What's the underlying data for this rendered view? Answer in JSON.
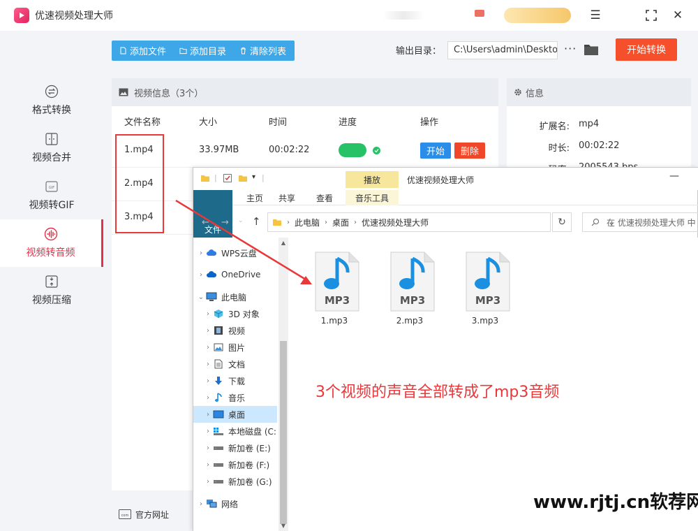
{
  "app": {
    "title": "优速视频处理大师"
  },
  "sidebar": {
    "items": [
      {
        "label": "格式转换",
        "icon": "swap-icon",
        "active": false
      },
      {
        "label": "视频合并",
        "icon": "merge-icon",
        "active": false
      },
      {
        "label": "视频转GIF",
        "icon": "gif-icon",
        "active": false
      },
      {
        "label": "视频转音频",
        "icon": "audio-icon",
        "active": true
      },
      {
        "label": "视频压缩",
        "icon": "compress-icon",
        "active": false
      }
    ]
  },
  "toolbar": {
    "add_file": "添加文件",
    "add_folder": "添加目录",
    "clear_list": "清除列表",
    "output_label": "输出目录：",
    "output_path": "C:\\Users\\admin\\Desktop",
    "more": "···",
    "start_convert": "开始转换"
  },
  "video_panel": {
    "title": "视频信息（3个）",
    "columns": [
      "文件名称",
      "大小",
      "时间",
      "进度",
      "操作"
    ],
    "rows": [
      {
        "name": "1.mp4",
        "size": "33.97MB",
        "time": "00:02:22",
        "progress": 1.0
      },
      {
        "name": "2.mp4",
        "size": "",
        "time": "",
        "progress": null
      },
      {
        "name": "3.mp4",
        "size": "",
        "time": "",
        "progress": null
      }
    ],
    "start_label": "开始",
    "delete_label": "删除"
  },
  "info_panel": {
    "title": "信息",
    "fields": [
      {
        "key": "扩展名:",
        "value": "mp4"
      },
      {
        "key": "时长:",
        "value": "00:02:22"
      },
      {
        "key": "码率:",
        "value": "2005543 bps"
      }
    ]
  },
  "footer": {
    "website": "官方网址"
  },
  "explorer": {
    "play_tab": "播放",
    "window_title": "优速视频处理大师",
    "ribbon_tabs": [
      "文件",
      "主页",
      "共享",
      "查看",
      "音乐工具"
    ],
    "breadcrumb": [
      "此电脑",
      "桌面",
      "优速视频处理大师"
    ],
    "search_placeholder": "在 优速视频处理大师 中",
    "nav": [
      {
        "label": "WPS云盘",
        "chev": "›",
        "indent": 0
      },
      {
        "label": "OneDrive",
        "chev": "›",
        "indent": 0
      },
      {
        "label": "此电脑",
        "chev": "⌄",
        "indent": 0
      },
      {
        "label": "3D 对象",
        "chev": "›",
        "indent": 1
      },
      {
        "label": "视频",
        "chev": "›",
        "indent": 1
      },
      {
        "label": "图片",
        "chev": "›",
        "indent": 1
      },
      {
        "label": "文档",
        "chev": "›",
        "indent": 1
      },
      {
        "label": "下载",
        "chev": "›",
        "indent": 1
      },
      {
        "label": "音乐",
        "chev": "›",
        "indent": 1
      },
      {
        "label": "桌面",
        "chev": "›",
        "indent": 1,
        "selected": true
      },
      {
        "label": "本地磁盘 (C:",
        "chev": "›",
        "indent": 1
      },
      {
        "label": "新加卷 (E:)",
        "chev": "›",
        "indent": 1
      },
      {
        "label": "新加卷 (F:)",
        "chev": "›",
        "indent": 1
      },
      {
        "label": "新加卷 (G:)",
        "chev": "›",
        "indent": 1
      },
      {
        "label": "网络",
        "chev": "›",
        "indent": 0
      }
    ],
    "files": [
      {
        "name": "1.mp3",
        "badge": "MP3"
      },
      {
        "name": "2.mp3",
        "badge": "MP3"
      },
      {
        "name": "3.mp3",
        "badge": "MP3"
      }
    ]
  },
  "annotation": "3个视频的声音全部转成了mp3音频",
  "watermark": "www.rjtj.cn软荐网",
  "colors": {
    "accent_red": "#e0324a",
    "toolbar_blue": "#3ea7e8",
    "start_orange": "#f5502b",
    "progress_green": "#27c265",
    "start_blue": "#2a8de8",
    "delete_red": "#f0462a",
    "ribbon_file": "#1d6a8b",
    "annotation_red": "#e8383a",
    "mp3_blue": "#1b8fe0"
  }
}
